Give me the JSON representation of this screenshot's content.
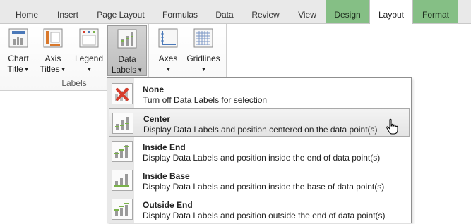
{
  "tabs": [
    {
      "label": "Home"
    },
    {
      "label": "Insert"
    },
    {
      "label": "Page Layout"
    },
    {
      "label": "Formulas"
    },
    {
      "label": "Data"
    },
    {
      "label": "Review"
    },
    {
      "label": "View"
    },
    {
      "label": "Design"
    },
    {
      "label": "Layout"
    },
    {
      "label": "Format"
    }
  ],
  "ribbon": {
    "chart_title": {
      "line1": "Chart",
      "line2": "Title"
    },
    "axis_titles": {
      "line1": "Axis",
      "line2": "Titles"
    },
    "legend": {
      "line1": "Legend"
    },
    "data_labels": {
      "line1": "Data",
      "line2": "Labels"
    },
    "axes": {
      "line1": "Axes"
    },
    "gridlines": {
      "line1": "Gridlines"
    },
    "group_label": "Labels"
  },
  "dropdown": {
    "items": [
      {
        "title": "None",
        "desc": "Turn off Data Labels for selection",
        "icon": "none-x-icon"
      },
      {
        "title": "Center",
        "desc": "Display Data Labels and position centered on the data point(s)",
        "icon": "center-labels-icon"
      },
      {
        "title": "Inside End",
        "desc": "Display Data Labels and position inside the end of data point(s)",
        "icon": "inside-end-labels-icon"
      },
      {
        "title": "Inside Base",
        "desc": "Display Data Labels and position inside the base of data point(s)",
        "icon": "inside-base-labels-icon"
      },
      {
        "title": "Outside End",
        "desc": "Display Data Labels and position outside the end of data point(s)",
        "icon": "outside-end-labels-icon"
      }
    ]
  },
  "colors": {
    "context_tab": "#85bf85",
    "label_green": "#7ab24a",
    "icon_blue": "#4a78b8",
    "delete_red": "#d63c2c"
  }
}
